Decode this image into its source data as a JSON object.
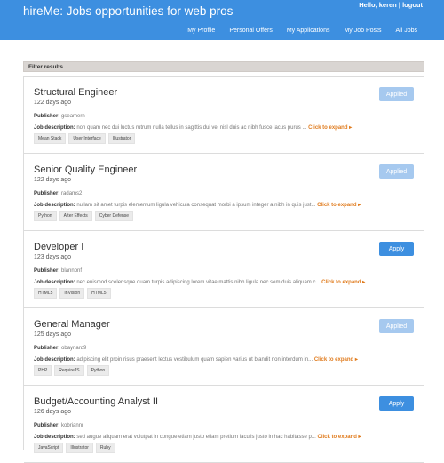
{
  "header": {
    "brand": "hireMe: Jobs opportunities for web pros",
    "greeting": "Hello, keren",
    "logout": "logout",
    "separator": "|"
  },
  "nav": {
    "items": [
      {
        "label": "My Profile"
      },
      {
        "label": "Personal Offers"
      },
      {
        "label": "My Applications"
      },
      {
        "label": "My Job Posts"
      },
      {
        "label": "All Jobs"
      }
    ]
  },
  "filter": {
    "label": "Filter results"
  },
  "labels": {
    "publisher": "Publisher:",
    "description": "Job description:",
    "expand": "Click to expand ▸"
  },
  "jobs": [
    {
      "title": "Structural Engineer",
      "date": "122 days ago",
      "publisher": "gseamern",
      "description": "non quam nec dui luctus rutrum nulla tellus in sagittis dui vel nisl duis ac nibh fusce lacus purus ...",
      "tags": [
        "Mean Stack",
        "User Interface",
        "Illustrator"
      ],
      "button": "Applied",
      "applied": true
    },
    {
      "title": "Senior Quality Engineer",
      "date": "122 days ago",
      "publisher": "radams2",
      "description": "nullam sit amet turpis elementum ligula vehicula consequat morbi a ipsum integer a nibh in quis just...",
      "tags": [
        "Python",
        "After Effects",
        "Cyber Defense"
      ],
      "button": "Applied",
      "applied": true
    },
    {
      "title": "Developer I",
      "date": "123 days ago",
      "publisher": "blannonf",
      "description": "nec euismod scelerisque quam turpis adipiscing lorem vitae mattis nibh ligula nec sem duis aliquam c...",
      "tags": [
        "HTML5",
        "InVision",
        "HTML5"
      ],
      "button": "Apply",
      "applied": false
    },
    {
      "title": "General Manager",
      "date": "125 days ago",
      "publisher": "obaynard9",
      "description": "adipiscing elit proin risus praesent lectus vestibulum quam sapien varius ut blandit non interdum in...",
      "tags": [
        "PHP",
        "RequireJS",
        "Python"
      ],
      "button": "Applied",
      "applied": true
    },
    {
      "title": "Budget/Accounting Analyst II",
      "date": "126 days ago",
      "publisher": "kobriannr",
      "description": "sed augue aliquam erat volutpat in congue etiam justo etiam pretium iaculis justo in hac habitasse p...",
      "tags": [
        "JavaScript",
        "Illustrator",
        "Ruby"
      ],
      "button": "Apply",
      "applied": false
    }
  ]
}
